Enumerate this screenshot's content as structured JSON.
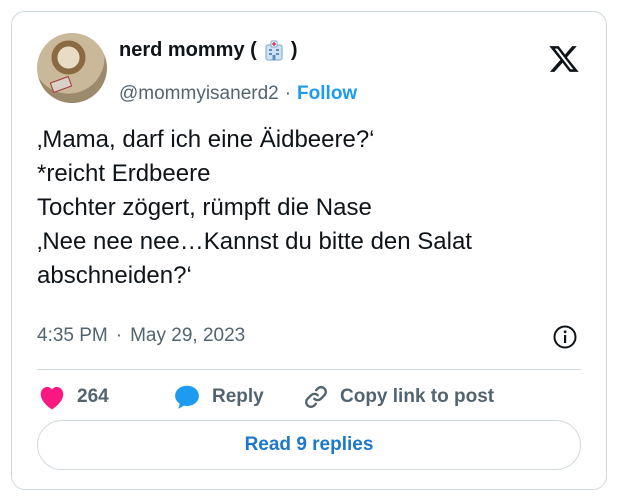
{
  "author": {
    "display_name": "nerd mommy (",
    "display_name_end": ")",
    "handle": "@mommyisanerd2",
    "separator": "·",
    "follow_label": "Follow"
  },
  "tweet": {
    "lines": [
      "‚Mama, darf ich eine Äidbeere?‘",
      "*reicht Erdbeere",
      "Tochter zögert, rümpft die Nase",
      "‚Nee nee nee…Kannst du bitte den Salat",
      "abschneiden?‘"
    ],
    "time": "4:35 PM",
    "separator": "·",
    "date": "May 29, 2023"
  },
  "actions": {
    "like_count": "264",
    "reply_label": "Reply",
    "copy_label": "Copy link to post"
  },
  "read_replies_label": "Read 9 replies",
  "colors": {
    "accent": "#1d9bf0",
    "like": "#f91880",
    "muted": "#536471",
    "border": "#cfd9de"
  },
  "icons": [
    "x-logo-icon",
    "hospital-emoji-icon",
    "info-icon",
    "heart-icon",
    "reply-bubble-icon",
    "link-icon"
  ]
}
